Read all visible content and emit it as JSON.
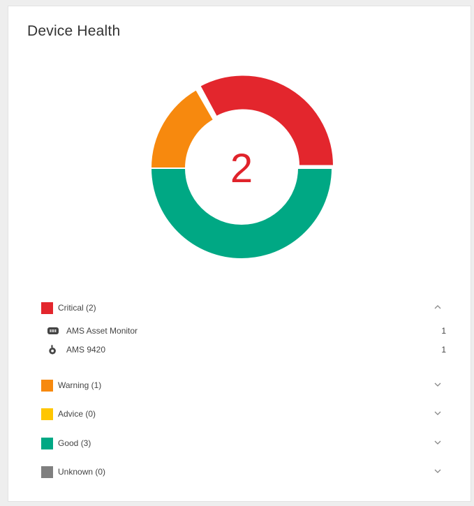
{
  "card": {
    "title": "Device Health"
  },
  "donut": {
    "center_value": "2",
    "colors": {
      "critical": "#e3262d",
      "warning": "#f7890e",
      "good": "#00a884",
      "advice": "#ffc600",
      "unknown": "#7f7f7f"
    }
  },
  "legend": [
    {
      "key": "critical",
      "label": "Critical (2)",
      "color": "#e3262d",
      "expanded": true,
      "devices": [
        {
          "icon": "asset-monitor-icon",
          "label": "AMS Asset Monitor",
          "count": "1"
        },
        {
          "icon": "ams-9420-icon",
          "label": "AMS 9420",
          "count": "1"
        }
      ]
    },
    {
      "key": "warning",
      "label": "Warning (1)",
      "color": "#f7890e",
      "expanded": false
    },
    {
      "key": "advice",
      "label": "Advice (0)",
      "color": "#ffc600",
      "expanded": false
    },
    {
      "key": "good",
      "label": "Good (3)",
      "color": "#00a884",
      "expanded": false
    },
    {
      "key": "unknown",
      "label": "Unknown (0)",
      "color": "#7f7f7f",
      "expanded": false
    }
  ],
  "chart_data": {
    "type": "pie",
    "categories": [
      "Critical",
      "Warning",
      "Good"
    ],
    "values": [
      2,
      1,
      3
    ]
  }
}
